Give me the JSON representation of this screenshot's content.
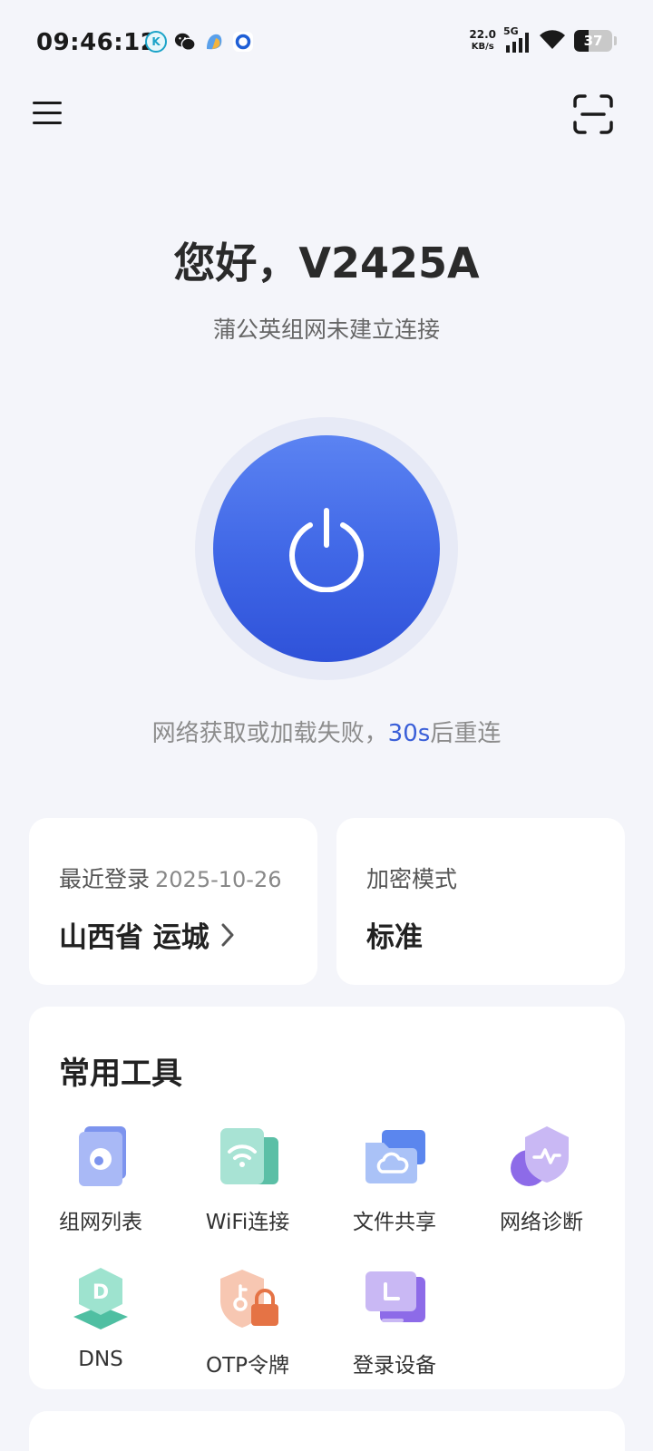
{
  "status_bar": {
    "time": "09:46:12",
    "net_speed_value": "22.0",
    "net_speed_unit": "KB/s",
    "network_type": "5G",
    "battery_level": "37"
  },
  "header": {
    "greeting": "您好，V2425A",
    "subtitle": "蒲公英组网未建立连接"
  },
  "connection": {
    "reconnect_prefix": "网络获取或加载失败，",
    "reconnect_count": "30s",
    "reconnect_suffix": "后重连"
  },
  "login_card": {
    "label": "最近登录",
    "date": "2025-10-26",
    "location": "山西省 运城"
  },
  "encryption_card": {
    "label": "加密模式",
    "value": "标准"
  },
  "tools": {
    "title": "常用工具",
    "items": [
      {
        "label": "组网列表",
        "icon": "network-list-icon"
      },
      {
        "label": "WiFi连接",
        "icon": "wifi-connect-icon"
      },
      {
        "label": "文件共享",
        "icon": "file-share-icon"
      },
      {
        "label": "网络诊断",
        "icon": "network-diagnosis-icon"
      },
      {
        "label": "DNS",
        "icon": "dns-icon"
      },
      {
        "label": "OTP令牌",
        "icon": "otp-token-icon"
      },
      {
        "label": "登录设备",
        "icon": "login-device-icon"
      }
    ]
  },
  "colors": {
    "accent": "#3f66e6",
    "background": "#f4f5fa",
    "card": "#ffffff"
  }
}
